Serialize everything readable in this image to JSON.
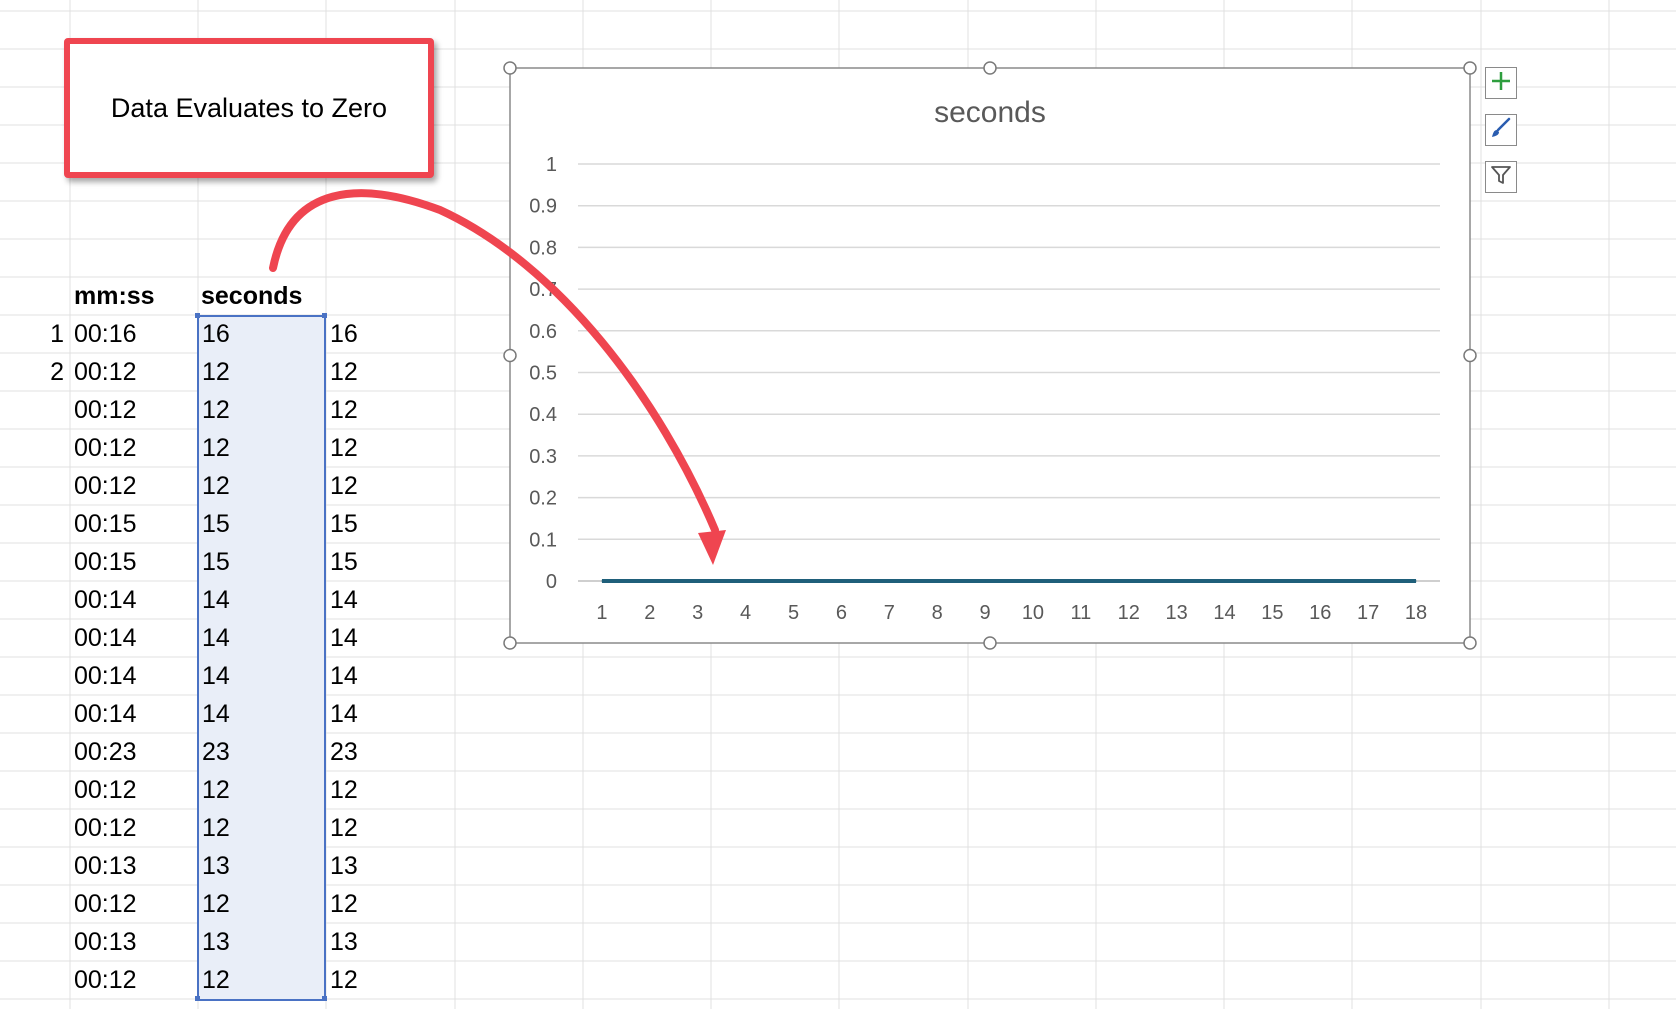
{
  "callout": {
    "text": "Data Evaluates to Zero"
  },
  "table": {
    "headers": {
      "mmss": "mm:ss",
      "seconds": "seconds"
    },
    "row_numbers": [
      "1",
      "2"
    ],
    "rows": [
      [
        "00:16",
        "16",
        "16"
      ],
      [
        "00:12",
        "12",
        "12"
      ],
      [
        "00:12",
        "12",
        "12"
      ],
      [
        "00:12",
        "12",
        "12"
      ],
      [
        "00:12",
        "12",
        "12"
      ],
      [
        "00:15",
        "15",
        "15"
      ],
      [
        "00:15",
        "15",
        "15"
      ],
      [
        "00:14",
        "14",
        "14"
      ],
      [
        "00:14",
        "14",
        "14"
      ],
      [
        "00:14",
        "14",
        "14"
      ],
      [
        "00:14",
        "14",
        "14"
      ],
      [
        "00:23",
        "23",
        "23"
      ],
      [
        "00:12",
        "12",
        "12"
      ],
      [
        "00:12",
        "12",
        "12"
      ],
      [
        "00:13",
        "13",
        "13"
      ],
      [
        "00:12",
        "12",
        "12"
      ],
      [
        "00:13",
        "13",
        "13"
      ],
      [
        "00:12",
        "12",
        "12"
      ]
    ]
  },
  "chart_data": {
    "type": "line",
    "title": "seconds",
    "categories": [
      "1",
      "2",
      "3",
      "4",
      "5",
      "6",
      "7",
      "8",
      "9",
      "10",
      "11",
      "12",
      "13",
      "14",
      "15",
      "16",
      "17",
      "18"
    ],
    "series": [
      {
        "values": [
          0,
          0,
          0,
          0,
          0,
          0,
          0,
          0,
          0,
          0,
          0,
          0,
          0,
          0,
          0,
          0,
          0,
          0
        ],
        "color": "#1f5f7a"
      }
    ],
    "ylim": [
      0,
      1
    ],
    "yticks": [
      "0",
      "0.1",
      "0.2",
      "0.3",
      "0.4",
      "0.5",
      "0.6",
      "0.7",
      "0.8",
      "0.9",
      "1"
    ],
    "grid": true,
    "legend": "none"
  },
  "chart_tools": [
    {
      "icon": "plus-icon"
    },
    {
      "icon": "brush-icon"
    },
    {
      "icon": "filter-icon"
    }
  ],
  "colors": {
    "callout_border": "#ef4550",
    "arrow": "#ef4550",
    "selection": "#4a72c4",
    "selection_fill": "#e9eef8",
    "series": "#1f5f7a"
  }
}
